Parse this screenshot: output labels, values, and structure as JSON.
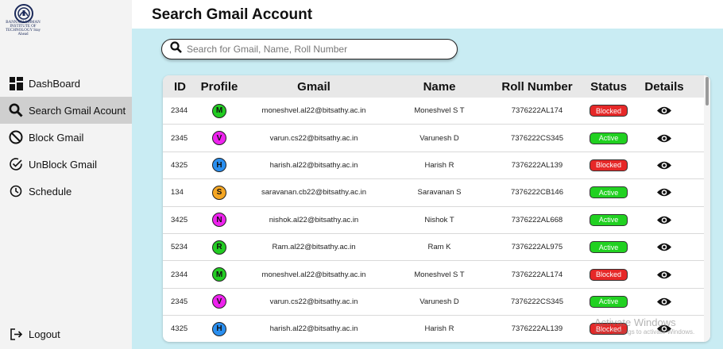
{
  "sidebar": {
    "logo_text": "BANNARI AMMAN INSTITUTE OF TECHNOLOGY Stay Ahead",
    "items": [
      {
        "label": "DashBoard",
        "icon": "dashboard-icon",
        "active": false
      },
      {
        "label": "Search Gmail Acount",
        "icon": "search-icon",
        "active": true
      },
      {
        "label": "Block Gmail",
        "icon": "block-icon",
        "active": false
      },
      {
        "label": "UnBlock Gmail",
        "icon": "check-circle-icon",
        "active": false
      },
      {
        "label": "Schedule",
        "icon": "clock-icon",
        "active": false
      }
    ],
    "logout_label": "Logout"
  },
  "page": {
    "title": "Search Gmail Account"
  },
  "search": {
    "placeholder": "Search for Gmail, Name, Roll Number",
    "value": ""
  },
  "table": {
    "headers": [
      "ID",
      "Profile",
      "Gmail",
      "Name",
      "Roll Number",
      "Status",
      "Details"
    ],
    "rows": [
      {
        "id": "2344",
        "initial": "M",
        "color": "#22cc22",
        "gmail": "moneshvel.al22@bitsathy.ac.in",
        "name": "Moneshvel S T",
        "roll": "7376222AL174",
        "status": "Blocked"
      },
      {
        "id": "2345",
        "initial": "V",
        "color": "#ee22ee",
        "gmail": "varun.cs22@bitsathy.ac.in",
        "name": "Varunesh D",
        "roll": "7376222CS345",
        "status": "Active"
      },
      {
        "id": "4325",
        "initial": "H",
        "color": "#2a8ff0",
        "gmail": "harish.al22@bitsathy.ac.in",
        "name": "Harish R",
        "roll": "7376222AL139",
        "status": "Blocked"
      },
      {
        "id": "134",
        "initial": "S",
        "color": "#f5a623",
        "gmail": "saravanan.cb22@bitsathy.ac.in",
        "name": "Saravanan S",
        "roll": "7376222CB146",
        "status": "Active"
      },
      {
        "id": "3425",
        "initial": "N",
        "color": "#ee22ee",
        "gmail": "nishok.al22@bitsathy.ac.in",
        "name": "Nishok T",
        "roll": "7376222AL668",
        "status": "Active"
      },
      {
        "id": "5234",
        "initial": "R",
        "color": "#22cc22",
        "gmail": "Ram.al22@bitsathy.ac.in",
        "name": "Ram K",
        "roll": "7376222AL975",
        "status": "Active"
      },
      {
        "id": "2344",
        "initial": "M",
        "color": "#22cc22",
        "gmail": "moneshvel.al22@bitsathy.ac.in",
        "name": "Moneshvel S T",
        "roll": "7376222AL174",
        "status": "Blocked"
      },
      {
        "id": "2345",
        "initial": "V",
        "color": "#ee22ee",
        "gmail": "varun.cs22@bitsathy.ac.in",
        "name": "Varunesh D",
        "roll": "7376222CS345",
        "status": "Active"
      },
      {
        "id": "4325",
        "initial": "H",
        "color": "#2a8ff0",
        "gmail": "harish.al22@bitsathy.ac.in",
        "name": "Harish R",
        "roll": "7376222AL139",
        "status": "Blocked"
      }
    ]
  },
  "status_colors": {
    "Blocked": "#e62828",
    "Active": "#21d121"
  },
  "watermark": {
    "line1": "Activate Windows",
    "line2": "Go to Settings to activate Windows."
  }
}
